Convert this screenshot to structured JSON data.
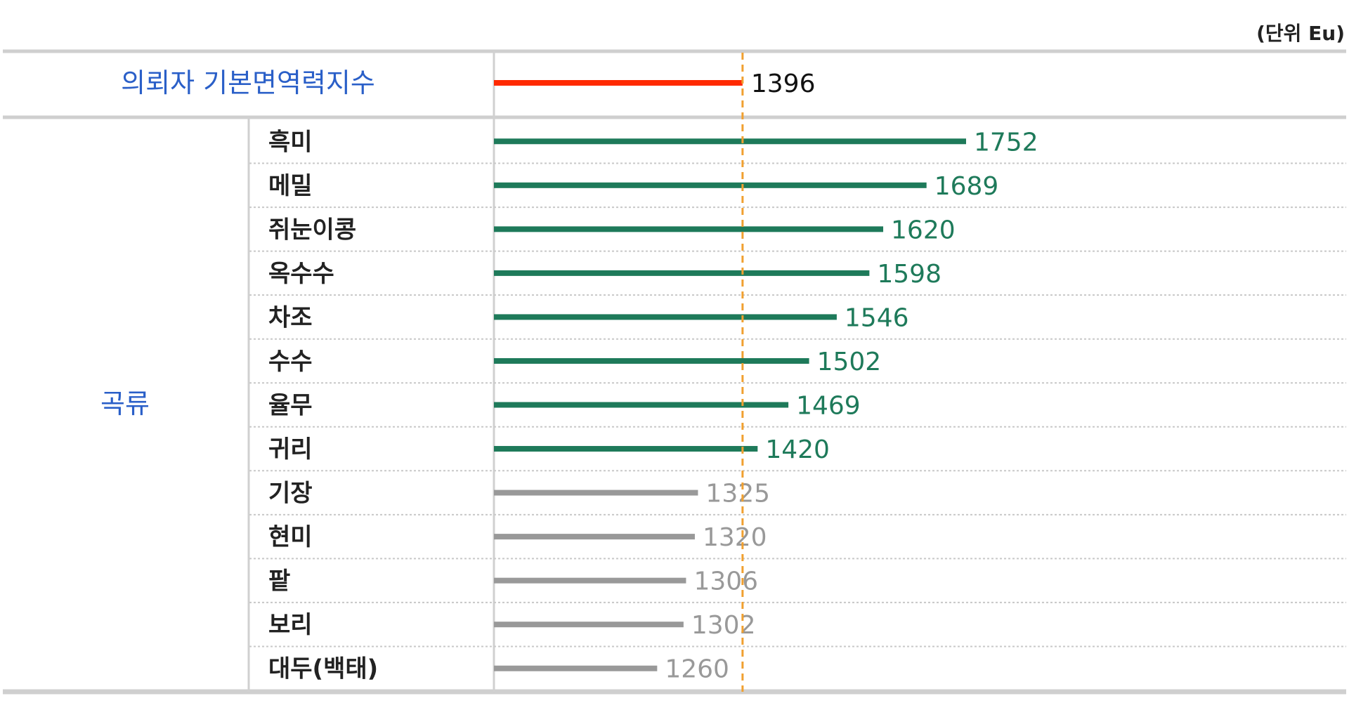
{
  "unit_note": "(단위 Eu)",
  "colors": {
    "reference_bar": "#ff2a00",
    "above_reference": "#1e7a5a",
    "below_reference": "#999999",
    "group_label": "#2a5fc8",
    "reference_line": "#f0a030"
  },
  "chart_data": {
    "type": "bar",
    "orientation": "horizontal",
    "unit": "Eu",
    "reference": {
      "label": "의뢰자 기본면역력지수",
      "value": 1396
    },
    "group_label": "곡류",
    "categories": [
      "흑미",
      "메밀",
      "쥐눈이콩",
      "옥수수",
      "차조",
      "수수",
      "율무",
      "귀리",
      "기장",
      "현미",
      "팥",
      "보리",
      "대두(백태)"
    ],
    "values": [
      1752,
      1689,
      1620,
      1598,
      1546,
      1502,
      1469,
      1420,
      1325,
      1320,
      1306,
      1302,
      1260
    ],
    "value_labels": [
      "1752",
      "1689",
      "1620",
      "1598",
      "1546",
      "1502",
      "1469",
      "1420",
      "1325",
      "1320",
      "1306",
      "1302",
      "1260"
    ],
    "grid": false,
    "legend": "none"
  }
}
